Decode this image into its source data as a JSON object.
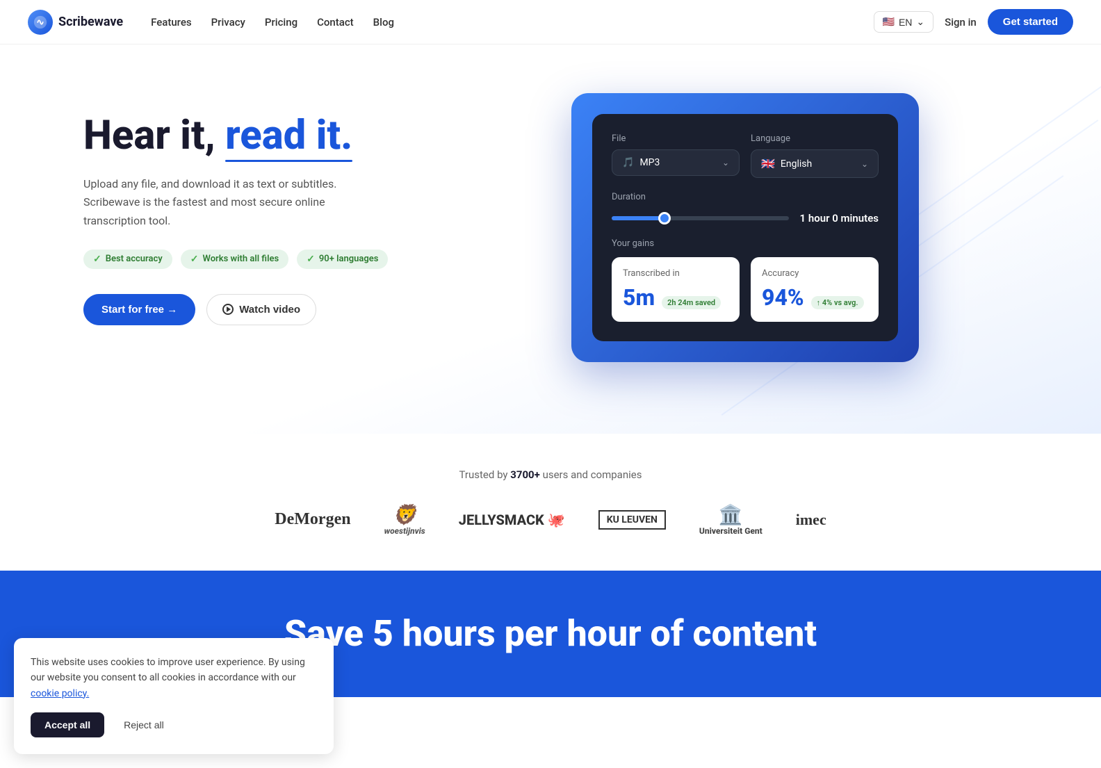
{
  "navbar": {
    "logo_text": "Scribewave",
    "nav_links": [
      {
        "label": "Features",
        "href": "#"
      },
      {
        "label": "Privacy",
        "href": "#"
      },
      {
        "label": "Pricing",
        "href": "#"
      },
      {
        "label": "Contact",
        "href": "#"
      },
      {
        "label": "Blog",
        "href": "#"
      }
    ],
    "lang_label": "EN",
    "sign_in_label": "Sign in",
    "get_started_label": "Get started"
  },
  "hero": {
    "title_part1": "Hear it, ",
    "title_accent": "read it.",
    "description": "Upload any file, and download it as text or subtitles. Scribewave is the fastest and most secure online transcription tool.",
    "badges": [
      {
        "text": "Best accuracy"
      },
      {
        "text": "Works with all files"
      },
      {
        "text": "90+ languages"
      }
    ],
    "start_btn": "Start for free →",
    "watch_btn": "Watch video"
  },
  "ui_demo": {
    "file_label": "File",
    "file_value": "MP3",
    "language_label": "Language",
    "language_flag": "🇬🇧",
    "language_value": "English",
    "duration_label": "Duration",
    "duration_value": "1 hour 0 minutes",
    "your_gains_label": "Your gains",
    "transcribed_label": "Transcribed in",
    "transcribed_value": "5m",
    "time_saved_badge": "2h 24m saved",
    "accuracy_label": "Accuracy",
    "accuracy_value": "94%",
    "accuracy_badge": "↑ 4% vs avg."
  },
  "trusted": {
    "text_prefix": "Trusted by ",
    "count": "3700+",
    "text_suffix": " users and companies",
    "logos": [
      {
        "name": "DeMorgen",
        "style": "demorgen"
      },
      {
        "name": "woestijnvis",
        "style": "woestijnvis"
      },
      {
        "name": "JELLYSMACK 🐙",
        "style": "jellysmack"
      },
      {
        "name": "KU LEUVEN",
        "style": "kuleuven"
      },
      {
        "name": "Universiteit Gent",
        "style": "ugent"
      },
      {
        "name": "imec",
        "style": "imec"
      }
    ]
  },
  "blue_banner": {
    "text": "Save 5 hours per hour of content"
  },
  "cookie": {
    "message": "This website uses cookies to improve user experience. By using our website you consent to all cookies in accordance with our ",
    "link_text": "cookie policy.",
    "accept_label": "Accept all",
    "reject_label": "Reject all"
  }
}
